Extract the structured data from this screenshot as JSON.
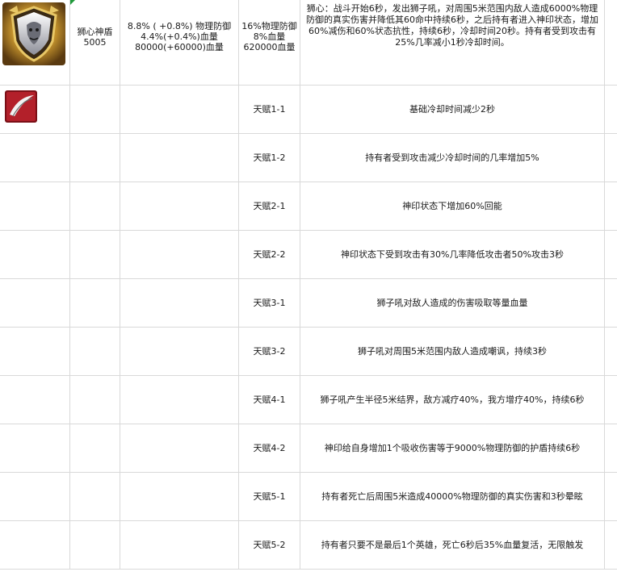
{
  "item": {
    "name": "狮心神盾",
    "id": "5005",
    "stats_base": "8.8% ( +0.8%) 物理防御\n4.4%(+0.4%)血量\n80000(+60000)血量",
    "stats_max": "16%物理防御\n8%血量\n620000血量",
    "skill_desc": "狮心：战斗开始6秒，发出狮子吼，对周围5米范围内敌人造成6000%物理防御的真实伤害并降低其60命中持续6秒，之后持有者进入神印状态，增加60%减伤和60%状态抗性，持续6秒，冷却时间20秒。持有者受到攻击有25%几率减小1秒冷却时间。",
    "icon": "lion-shield-icon"
  },
  "talent_icon": "red-blade-icon",
  "talents": [
    {
      "label": "天赋1-1",
      "desc": "基础冷却时间减少2秒"
    },
    {
      "label": "天赋1-2",
      "desc": "持有者受到攻击减少冷却时间的几率增加5%"
    },
    {
      "label": "天赋2-1",
      "desc": "神印状态下增加60%回能"
    },
    {
      "label": "天赋2-2",
      "desc": "神印状态下受到攻击有30%几率降低攻击者50%攻击3秒"
    },
    {
      "label": "天赋3-1",
      "desc": "狮子吼对敌人造成的伤害吸取等量血量"
    },
    {
      "label": "天赋3-2",
      "desc": "狮子吼对周围5米范围内敌人造成嘲讽，持续3秒"
    },
    {
      "label": "天赋4-1",
      "desc": "狮子吼产生半径5米结界，敌方减疗40%，我方增疗40%，持续6秒"
    },
    {
      "label": "天赋4-2",
      "desc": "神印给自身增加1个吸收伤害等于9000%物理防御的护盾持续6秒"
    },
    {
      "label": "天赋5-1",
      "desc": "持有者死亡后周围5米造成40000%物理防御的真实伤害和3秒晕眩"
    },
    {
      "label": "天赋5-2",
      "desc": "持有者只要不是最后1个英雄，死亡6秒后35%血量复活，无限触发"
    }
  ],
  "colors": {
    "gridline": "#d9d9d9",
    "flag": "#1f9a3a"
  }
}
